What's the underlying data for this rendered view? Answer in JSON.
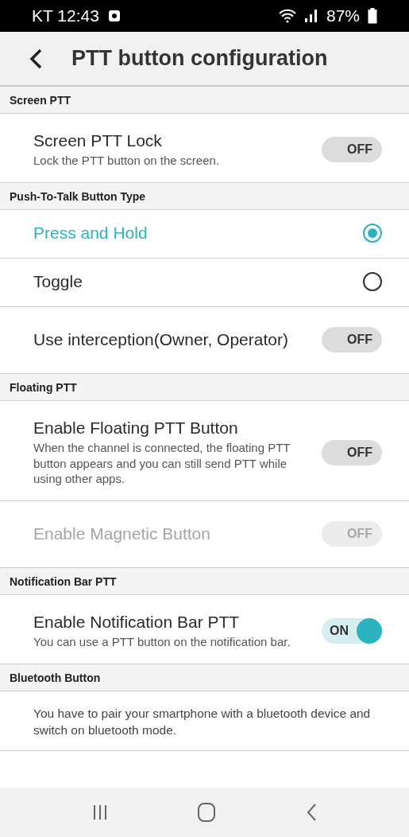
{
  "status_bar": {
    "carrier_time": "KT 12:43",
    "battery": "87%"
  },
  "header": {
    "title": "PTT button configuration"
  },
  "sections": [
    {
      "title": "Screen PTT",
      "items": [
        {
          "kind": "toggle",
          "label": "Screen PTT Lock",
          "description": "Lock the PTT button on the screen.",
          "on": false,
          "disabled": false,
          "switch_text": "OFF"
        }
      ]
    },
    {
      "title": "Push-To-Talk Button Type",
      "items": [
        {
          "kind": "radio",
          "label": "Press and Hold",
          "selected": true
        },
        {
          "kind": "radio",
          "label": "Toggle",
          "selected": false
        },
        {
          "kind": "toggle",
          "label": "Use interception(Owner, Operator)",
          "on": false,
          "disabled": false,
          "switch_text": "OFF"
        }
      ]
    },
    {
      "title": "Floating PTT",
      "items": [
        {
          "kind": "toggle",
          "label": "Enable Floating PTT Button",
          "description": "When the channel is connected, the floating PTT button appears and you can still send PTT while using other apps.",
          "on": false,
          "disabled": false,
          "switch_text": "OFF"
        },
        {
          "kind": "toggle",
          "label": "Enable Magnetic Button",
          "on": false,
          "disabled": true,
          "switch_text": "OFF"
        }
      ]
    },
    {
      "title": "Notification Bar PTT",
      "items": [
        {
          "kind": "toggle",
          "label": "Enable Notification Bar PTT",
          "description": "You can use a PTT button on the notification bar.",
          "on": true,
          "disabled": false,
          "switch_text": "ON"
        }
      ]
    },
    {
      "title": "Bluetooth Button",
      "items": [
        {
          "kind": "info",
          "description": "You have to pair your smartphone with a bluetooth device and switch on bluetooth mode."
        }
      ]
    }
  ]
}
